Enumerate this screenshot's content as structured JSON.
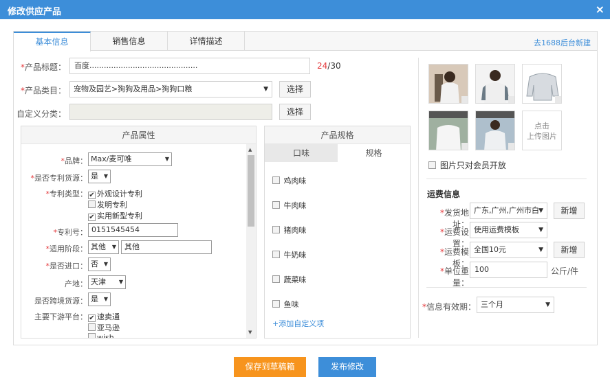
{
  "dialog": {
    "title": "修改供应产品",
    "close_glyph": "×"
  },
  "tabs": [
    "基本信息",
    "销售信息",
    "详情描述"
  ],
  "tab_link": "去1688后台新建",
  "form": {
    "title_label": "产品标题：",
    "title_value": "百度.............................................",
    "title_count_used": "24",
    "title_count_max": "/30",
    "category_label": "产品类目：",
    "category_value": "宠物及园艺>狗狗及用品>狗狗口粮",
    "category_button": "选择",
    "custom_label": "自定义分类：",
    "custom_value": "",
    "custom_button": "选择",
    "required_mark": "*"
  },
  "attrs": {
    "header": "产品属性",
    "brand_label": "品牌：",
    "brand_value": "Max/麦可唯",
    "patent_source_label": "是否专利货源：",
    "patent_source_value": "是",
    "patent_type_label": "专利类型：",
    "patent_types": [
      {
        "label": "外观设计专利",
        "checked": true
      },
      {
        "label": "发明专利",
        "checked": false
      },
      {
        "label": "实用新型专利",
        "checked": true
      }
    ],
    "patent_no_label": "专利号：",
    "patent_no_value": "0151545454",
    "stage_label": "适用阶段：",
    "stage_select": "其他",
    "stage_input": "其他",
    "import_label": "是否进口：",
    "import_value": "否",
    "origin_label": "产地：",
    "origin_value": "天津",
    "cross_border_label": "是否跨境货源：",
    "cross_border_value": "是",
    "platform_label": "主要下游平台：",
    "platforms": [
      {
        "label": "速卖通",
        "checked": true
      },
      {
        "label": "亚马逊",
        "checked": false
      },
      {
        "label": "wish",
        "checked": false
      }
    ],
    "check_glyph": "✔",
    "arrow": "▼",
    "scroll_up": "▲",
    "scroll_down": "▼"
  },
  "specs": {
    "header": "产品规格",
    "tabs": [
      "口味",
      "规格"
    ],
    "items": [
      "鸡肉味",
      "牛肉味",
      "猪肉味",
      "牛奶味",
      "蔬菜味",
      "鱼味"
    ],
    "add_link": "+添加自定义项"
  },
  "images": {
    "upload_label_1": "点击",
    "upload_label_2": "上传图片",
    "member_only_label": "图片只对会员开放",
    "delete_glyph": "×"
  },
  "shipping": {
    "section_title": "运费信息",
    "address_label": "发货地址：",
    "address_value": "广东,广州,广州市白",
    "address_button": "新增",
    "setting_label": "运费设置：",
    "setting_value": "使用运费模板",
    "template_label": "运费模板：",
    "template_value": "全国10元",
    "template_button": "新增",
    "weight_label": "单位重量：",
    "weight_value": "100",
    "weight_unit": "公斤/件",
    "validity_label": "信息有效期：",
    "validity_value": "三个月"
  },
  "footer": {
    "draft_button": "保存到草稿箱",
    "publish_button": "发布修改"
  },
  "colors": {
    "accent": "#3d8ed9",
    "draft": "#f7941d",
    "publish": "#3d8ed9",
    "required": "#e4393c"
  }
}
